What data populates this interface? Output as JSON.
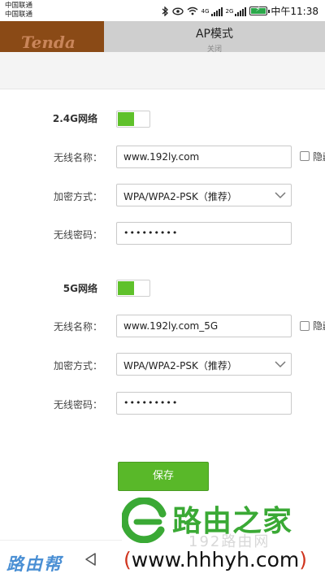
{
  "status_bar": {
    "carrier_1": "中国联通",
    "carrier_2": "中国联通",
    "net_1": "4G",
    "net_2": "2G",
    "time": "中午11:38",
    "icons": [
      "bluetooth-icon",
      "eye-icon",
      "wifi-icon",
      "signal-icon",
      "battery-icon"
    ]
  },
  "header": {
    "brand": "Tenda",
    "title": "AP模式",
    "subtitle": "关闭"
  },
  "networks": [
    {
      "title": "2.4G网络",
      "enabled": true,
      "ssid_label": "无线名称：",
      "ssid": "www.192ly.com",
      "hide_label": "隐藏",
      "security_label": "加密方式：",
      "security": "WPA/WPA2-PSK（推荐）",
      "password_label": "无线密码：",
      "password_mask": "•••••••••"
    },
    {
      "title": "5G网络",
      "enabled": true,
      "ssid_label": "无线名称：",
      "ssid": "www.192ly.com_5G",
      "hide_label": "隐藏",
      "security_label": "加密方式：",
      "security": "WPA/WPA2-PSK（推荐）",
      "password_label": "无线密码：",
      "password_mask": "•••••••••"
    }
  ],
  "save_label": "保存",
  "watermark": {
    "cn": "路由之家",
    "faint": "192路由网",
    "url_open": "(",
    "url": "www.hhhyh.com",
    "url_close": ")"
  },
  "help_text": "路由帮",
  "colors": {
    "accent": "#5fc12b",
    "brand_bg": "#8a4a16",
    "header_bg": "#cfcfcf"
  }
}
